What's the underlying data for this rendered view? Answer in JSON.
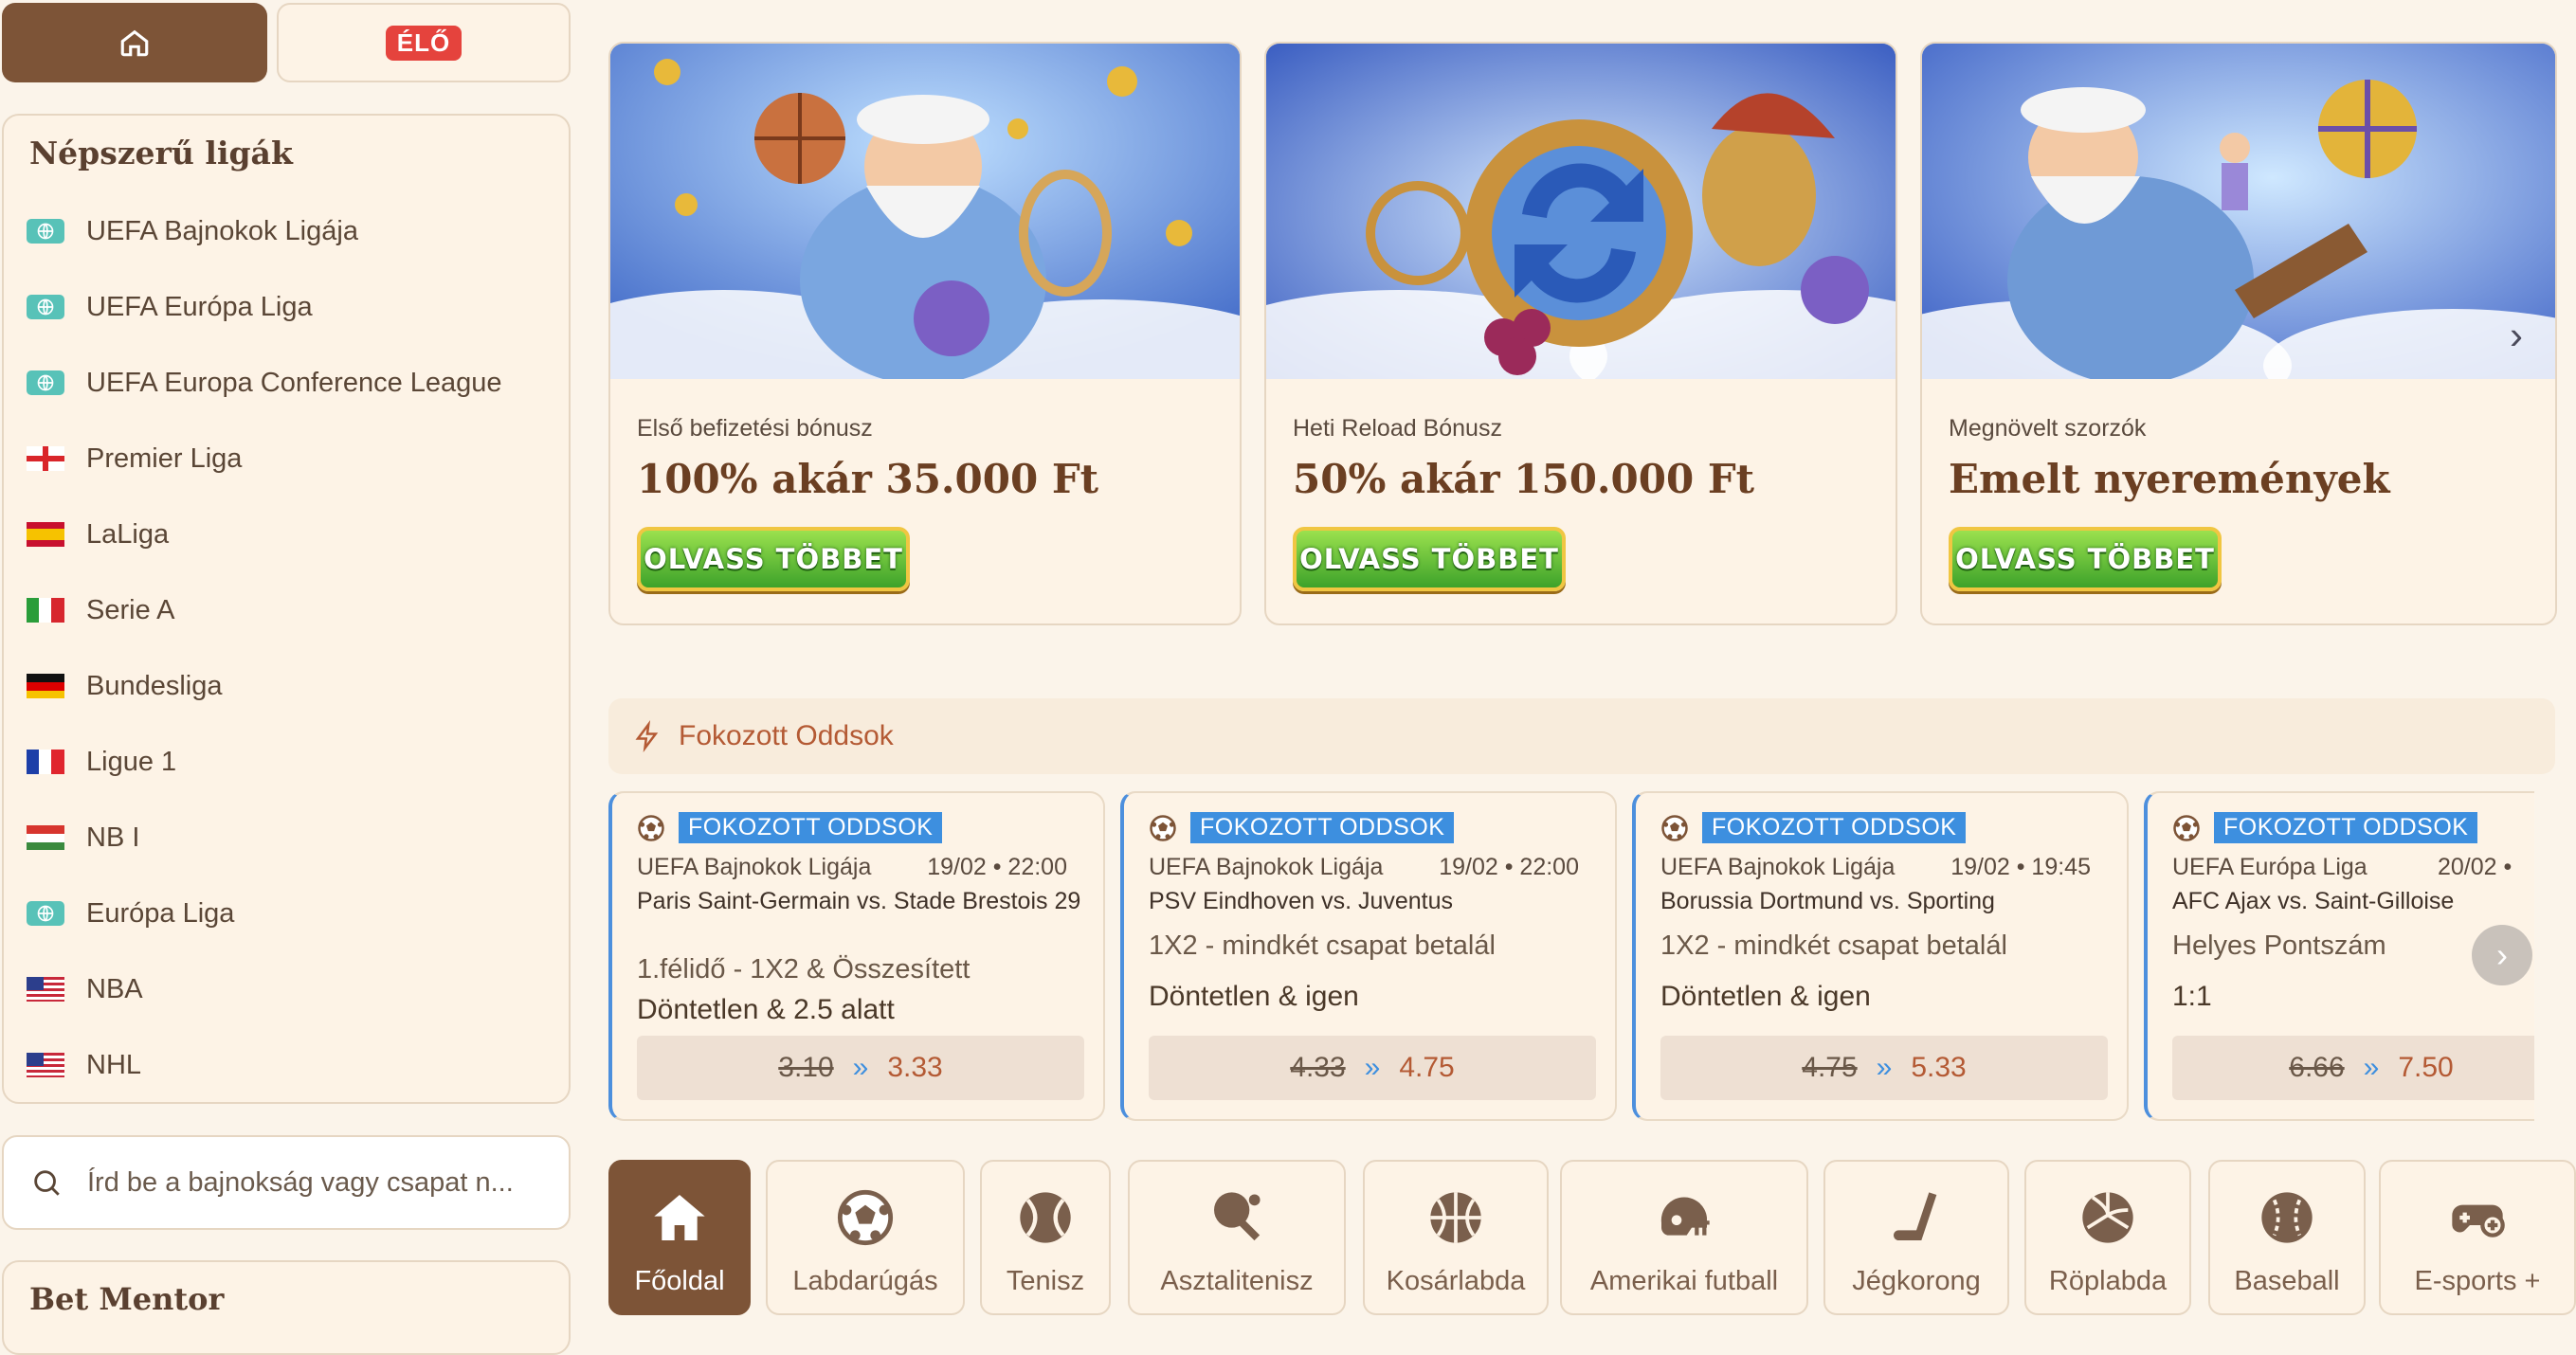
{
  "top": {
    "live_label": "ÉLŐ"
  },
  "leagues": {
    "title": "Népszerű ligák",
    "items": [
      {
        "label": "UEFA Bajnokok Ligája",
        "icon": "globe-icon"
      },
      {
        "label": "UEFA Európa Liga",
        "icon": "globe-icon"
      },
      {
        "label": "UEFA Europa Conference League",
        "icon": "globe-icon"
      },
      {
        "label": "Premier Liga",
        "icon": "england-flag-icon"
      },
      {
        "label": "LaLiga",
        "icon": "spain-flag-icon"
      },
      {
        "label": "Serie A",
        "icon": "italy-flag-icon"
      },
      {
        "label": "Bundesliga",
        "icon": "germany-flag-icon"
      },
      {
        "label": "Ligue 1",
        "icon": "france-flag-icon"
      },
      {
        "label": "NB I",
        "icon": "hungary-flag-icon"
      },
      {
        "label": "Európa Liga",
        "icon": "globe-icon"
      },
      {
        "label": "NBA",
        "icon": "usa-flag-icon"
      },
      {
        "label": "NHL",
        "icon": "usa-flag-icon"
      }
    ]
  },
  "search": {
    "placeholder": "Írd be a bajnokság vagy csapat n..."
  },
  "bet_mentor": {
    "title": "Bet Mentor"
  },
  "promos": [
    {
      "subtitle": "Első befizetési bónusz",
      "title": "100% akár 35.000 Ft",
      "button": "OLVASS TÖBBET"
    },
    {
      "subtitle": "Heti Reload Bónusz",
      "title": "50% akár 150.000 Ft",
      "button": "OLVASS TÖBBET"
    },
    {
      "subtitle": "Megnövelt szorzók",
      "title": "Emelt nyeremények",
      "button": "OLVASS TÖBBET"
    }
  ],
  "boosted": {
    "title": "Fokozott Oddsok",
    "cards": [
      {
        "tag": "FOKOZOTT ODDSOK",
        "league": "UEFA Bajnokok Ligája",
        "datetime": "19/02 • 22:00",
        "match": "Paris Saint-Germain vs. Stade Brestois 29",
        "market": "1.félidő - 1X2 & Összesített",
        "selection": "Döntetlen & 2.5 alatt",
        "old_odds": "3.10",
        "new_odds": "3.33"
      },
      {
        "tag": "FOKOZOTT ODDSOK",
        "league": "UEFA Bajnokok Ligája",
        "datetime": "19/02 • 22:00",
        "match": "PSV Eindhoven vs. Juventus",
        "market": "1X2 - mindkét csapat betalál",
        "selection": "Döntetlen & igen",
        "old_odds": "4.33",
        "new_odds": "4.75"
      },
      {
        "tag": "FOKOZOTT ODDSOK",
        "league": "UEFA Bajnokok Ligája",
        "datetime": "19/02 • 19:45",
        "match": "Borussia Dortmund vs. Sporting",
        "market": "1X2 - mindkét csapat betalál",
        "selection": "Döntetlen & igen",
        "old_odds": "4.75",
        "new_odds": "5.33"
      },
      {
        "tag": "FOKOZOTT ODDSOK",
        "league": "UEFA Európa Liga",
        "datetime": "20/02 •",
        "match": "AFC Ajax vs. Saint-Gilloise",
        "market": "Helyes Pontszám",
        "selection": "1:1",
        "old_odds": "6.66",
        "new_odds": "7.50"
      }
    ]
  },
  "sports": [
    {
      "label": "Főoldal",
      "icon": "home-icon",
      "active": true
    },
    {
      "label": "Labdarúgás",
      "icon": "soccer-ball-icon"
    },
    {
      "label": "Tenisz",
      "icon": "tennis-ball-icon"
    },
    {
      "label": "Asztalitenisz",
      "icon": "table-tennis-icon"
    },
    {
      "label": "Kosárlabda",
      "icon": "basketball-icon"
    },
    {
      "label": "Amerikai futball",
      "icon": "football-helmet-icon"
    },
    {
      "label": "Jégkorong",
      "icon": "hockey-stick-icon"
    },
    {
      "label": "Röplabda",
      "icon": "volleyball-icon"
    },
    {
      "label": "Baseball",
      "icon": "baseball-icon"
    },
    {
      "label": "E-sports +",
      "icon": "gamepad-icon"
    }
  ],
  "colors": {
    "accent_brown": "#7d5437",
    "live_red": "#e5433d",
    "boost_blue": "#3d8fdf",
    "odds_orange": "#b45a34",
    "page_bg": "#fbf4ea"
  }
}
